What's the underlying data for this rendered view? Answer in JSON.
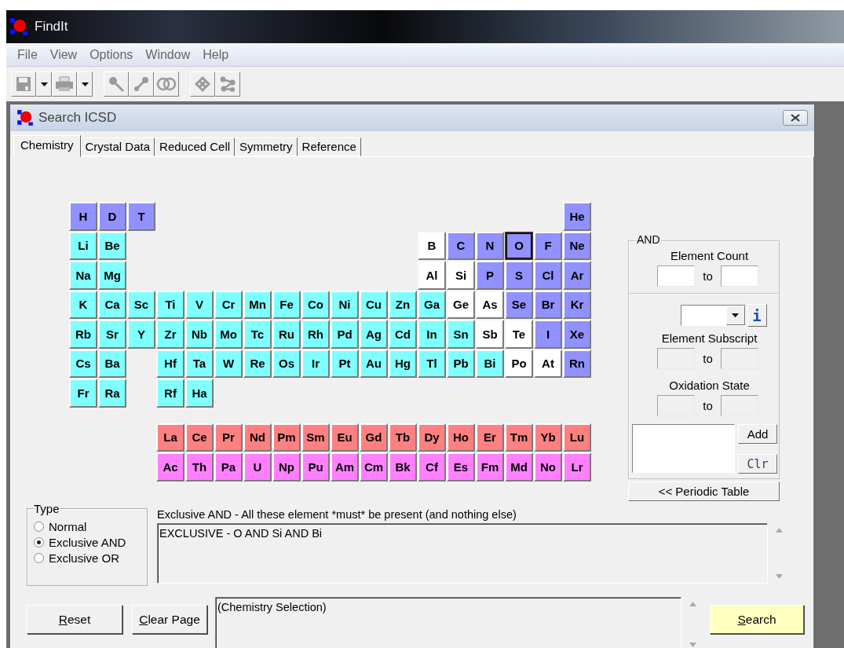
{
  "app": {
    "title": "FindIt"
  },
  "menu": [
    "File",
    "View",
    "Options",
    "Window",
    "Help"
  ],
  "window": {
    "title": "Search ICSD"
  },
  "tabs": [
    {
      "label": "Chemistry",
      "selected": true
    },
    {
      "label": "Crystal Data",
      "selected": false
    },
    {
      "label": "Reduced Cell",
      "selected": false
    },
    {
      "label": "Symmetry",
      "selected": false
    },
    {
      "label": "Reference",
      "selected": false
    }
  ],
  "periodic_table": {
    "main_rows": [
      [
        {
          "s": "H",
          "color": "#9191ff",
          "focused": false
        },
        {
          "s": "D",
          "color": "#9191ff",
          "focused": false
        },
        {
          "s": "T",
          "color": "#9191ff",
          "focused": false
        },
        null,
        null,
        null,
        null,
        null,
        null,
        null,
        null,
        null,
        null,
        null,
        null,
        null,
        null,
        {
          "s": "He",
          "color": "#9191ff",
          "focused": false
        }
      ],
      [
        {
          "s": "Li",
          "color": "#80ffff",
          "focused": false
        },
        {
          "s": "Be",
          "color": "#80ffff",
          "focused": false
        },
        null,
        null,
        null,
        null,
        null,
        null,
        null,
        null,
        null,
        null,
        {
          "s": "B",
          "color": "#ffffff",
          "focused": false
        },
        {
          "s": "C",
          "color": "#9191ff",
          "focused": false
        },
        {
          "s": "N",
          "color": "#9191ff",
          "focused": false
        },
        {
          "s": "O",
          "color": "#9191ff",
          "focused": true
        },
        {
          "s": "F",
          "color": "#9191ff",
          "focused": false
        },
        {
          "s": "Ne",
          "color": "#9191ff",
          "focused": false
        }
      ],
      [
        {
          "s": "Na",
          "color": "#80ffff",
          "focused": false
        },
        {
          "s": "Mg",
          "color": "#80ffff",
          "focused": false
        },
        null,
        null,
        null,
        null,
        null,
        null,
        null,
        null,
        null,
        null,
        {
          "s": "Al",
          "color": "#ffffff",
          "focused": false
        },
        {
          "s": "Si",
          "color": "#ffffff",
          "focused": false
        },
        {
          "s": "P",
          "color": "#9191ff",
          "focused": false
        },
        {
          "s": "S",
          "color": "#9191ff",
          "focused": false
        },
        {
          "s": "Cl",
          "color": "#9191ff",
          "focused": false
        },
        {
          "s": "Ar",
          "color": "#9191ff",
          "focused": false
        }
      ],
      [
        {
          "s": "K",
          "color": "#80ffff",
          "focused": false
        },
        {
          "s": "Ca",
          "color": "#80ffff",
          "focused": false
        },
        {
          "s": "Sc",
          "color": "#80ffff",
          "focused": false
        },
        {
          "s": "Ti",
          "color": "#80ffff",
          "focused": false
        },
        {
          "s": "V",
          "color": "#80ffff",
          "focused": false
        },
        {
          "s": "Cr",
          "color": "#80ffff",
          "focused": false
        },
        {
          "s": "Mn",
          "color": "#80ffff",
          "focused": false
        },
        {
          "s": "Fe",
          "color": "#80ffff",
          "focused": false
        },
        {
          "s": "Co",
          "color": "#80ffff",
          "focused": false
        },
        {
          "s": "Ni",
          "color": "#80ffff",
          "focused": false
        },
        {
          "s": "Cu",
          "color": "#80ffff",
          "focused": false
        },
        {
          "s": "Zn",
          "color": "#80ffff",
          "focused": false
        },
        {
          "s": "Ga",
          "color": "#80ffff",
          "focused": false
        },
        {
          "s": "Ge",
          "color": "#ffffff",
          "focused": false
        },
        {
          "s": "As",
          "color": "#ffffff",
          "focused": false
        },
        {
          "s": "Se",
          "color": "#9191ff",
          "focused": false
        },
        {
          "s": "Br",
          "color": "#9191ff",
          "focused": false
        },
        {
          "s": "Kr",
          "color": "#9191ff",
          "focused": false
        }
      ],
      [
        {
          "s": "Rb",
          "color": "#80ffff",
          "focused": false
        },
        {
          "s": "Sr",
          "color": "#80ffff",
          "focused": false
        },
        {
          "s": "Y",
          "color": "#80ffff",
          "focused": false
        },
        {
          "s": "Zr",
          "color": "#80ffff",
          "focused": false
        },
        {
          "s": "Nb",
          "color": "#80ffff",
          "focused": false
        },
        {
          "s": "Mo",
          "color": "#80ffff",
          "focused": false
        },
        {
          "s": "Tc",
          "color": "#80ffff",
          "focused": false
        },
        {
          "s": "Ru",
          "color": "#80ffff",
          "focused": false
        },
        {
          "s": "Rh",
          "color": "#80ffff",
          "focused": false
        },
        {
          "s": "Pd",
          "color": "#80ffff",
          "focused": false
        },
        {
          "s": "Ag",
          "color": "#80ffff",
          "focused": false
        },
        {
          "s": "Cd",
          "color": "#80ffff",
          "focused": false
        },
        {
          "s": "In",
          "color": "#80ffff",
          "focused": false
        },
        {
          "s": "Sn",
          "color": "#80ffff",
          "focused": false
        },
        {
          "s": "Sb",
          "color": "#ffffff",
          "focused": false
        },
        {
          "s": "Te",
          "color": "#ffffff",
          "focused": false
        },
        {
          "s": "I",
          "color": "#9191ff",
          "focused": false
        },
        {
          "s": "Xe",
          "color": "#9191ff",
          "focused": false
        }
      ],
      [
        {
          "s": "Cs",
          "color": "#80ffff",
          "focused": false
        },
        {
          "s": "Ba",
          "color": "#80ffff",
          "focused": false
        },
        null,
        {
          "s": "Hf",
          "color": "#80ffff",
          "focused": false
        },
        {
          "s": "Ta",
          "color": "#80ffff",
          "focused": false
        },
        {
          "s": "W",
          "color": "#80ffff",
          "focused": false
        },
        {
          "s": "Re",
          "color": "#80ffff",
          "focused": false
        },
        {
          "s": "Os",
          "color": "#80ffff",
          "focused": false
        },
        {
          "s": "Ir",
          "color": "#80ffff",
          "focused": false
        },
        {
          "s": "Pt",
          "color": "#80ffff",
          "focused": false
        },
        {
          "s": "Au",
          "color": "#80ffff",
          "focused": false
        },
        {
          "s": "Hg",
          "color": "#80ffff",
          "focused": false
        },
        {
          "s": "Tl",
          "color": "#80ffff",
          "focused": false
        },
        {
          "s": "Pb",
          "color": "#80ffff",
          "focused": false
        },
        {
          "s": "Bi",
          "color": "#80ffff",
          "focused": false
        },
        {
          "s": "Po",
          "color": "#ffffff",
          "focused": false
        },
        {
          "s": "At",
          "color": "#ffffff",
          "focused": false
        },
        {
          "s": "Rn",
          "color": "#9191ff",
          "focused": false
        }
      ],
      [
        {
          "s": "Fr",
          "color": "#80ffff",
          "focused": false
        },
        {
          "s": "Ra",
          "color": "#80ffff",
          "focused": false
        },
        null,
        {
          "s": "Rf",
          "color": "#80ffff",
          "focused": false
        },
        {
          "s": "Ha",
          "color": "#80ffff",
          "focused": false
        }
      ]
    ],
    "f_rows": [
      [
        null,
        null,
        null,
        {
          "s": "La",
          "color": "#ff8080",
          "focused": false
        },
        {
          "s": "Ce",
          "color": "#ff8080",
          "focused": false
        },
        {
          "s": "Pr",
          "color": "#ff8080",
          "focused": false
        },
        {
          "s": "Nd",
          "color": "#ff8080",
          "focused": false
        },
        {
          "s": "Pm",
          "color": "#ff8080",
          "focused": false
        },
        {
          "s": "Sm",
          "color": "#ff8080",
          "focused": false
        },
        {
          "s": "Eu",
          "color": "#ff8080",
          "focused": false
        },
        {
          "s": "Gd",
          "color": "#ff8080",
          "focused": false
        },
        {
          "s": "Tb",
          "color": "#ff8080",
          "focused": false
        },
        {
          "s": "Dy",
          "color": "#ff8080",
          "focused": false
        },
        {
          "s": "Ho",
          "color": "#ff8080",
          "focused": false
        },
        {
          "s": "Er",
          "color": "#ff8080",
          "focused": false
        },
        {
          "s": "Tm",
          "color": "#ff8080",
          "focused": false
        },
        {
          "s": "Yb",
          "color": "#ff8080",
          "focused": false
        },
        {
          "s": "Lu",
          "color": "#ff8080",
          "focused": false
        }
      ],
      [
        null,
        null,
        null,
        {
          "s": "Ac",
          "color": "#ff80ff",
          "focused": false
        },
        {
          "s": "Th",
          "color": "#ff80ff",
          "focused": false
        },
        {
          "s": "Pa",
          "color": "#ff80ff",
          "focused": false
        },
        {
          "s": "U",
          "color": "#ff80ff",
          "focused": false
        },
        {
          "s": "Np",
          "color": "#ff80ff",
          "focused": false
        },
        {
          "s": "Pu",
          "color": "#ff80ff",
          "focused": false
        },
        {
          "s": "Am",
          "color": "#ff80ff",
          "focused": false
        },
        {
          "s": "Cm",
          "color": "#ff80ff",
          "focused": false
        },
        {
          "s": "Bk",
          "color": "#ff80ff",
          "focused": false
        },
        {
          "s": "Cf",
          "color": "#ff80ff",
          "focused": false
        },
        {
          "s": "Es",
          "color": "#ff80ff",
          "focused": false
        },
        {
          "s": "Fm",
          "color": "#ff80ff",
          "focused": false
        },
        {
          "s": "Md",
          "color": "#ff80ff",
          "focused": false
        },
        {
          "s": "No",
          "color": "#ff80ff",
          "focused": false
        },
        {
          "s": "Lr",
          "color": "#ff80ff",
          "focused": false
        }
      ]
    ]
  },
  "criteria_panel": {
    "legend": "AND",
    "count": {
      "label": "Element Count",
      "to": "to",
      "disabled": false
    },
    "info_button": "i",
    "subscript": {
      "label": "Element Subscript",
      "to": "to",
      "disabled": true
    },
    "oxidation": {
      "label": "Oxidation State",
      "to": "to",
      "disabled": true
    },
    "add_button": "Add",
    "clear_button": "Clr",
    "toggle_button": "<< Periodic Table"
  },
  "type_group": {
    "legend": "Type",
    "options": [
      {
        "label": "Normal",
        "selected": false
      },
      {
        "label": "Exclusive AND",
        "selected": true
      },
      {
        "label": "Exclusive OR",
        "selected": false
      }
    ]
  },
  "description": "Exclusive AND - All these element *must* be present (and nothing else)",
  "expression": "EXCLUSIVE - O AND Si AND Bi",
  "buttons": {
    "reset": "Reset",
    "clear": "Clear Page",
    "search": "Search"
  },
  "status_text": "(Chemistry Selection)"
}
